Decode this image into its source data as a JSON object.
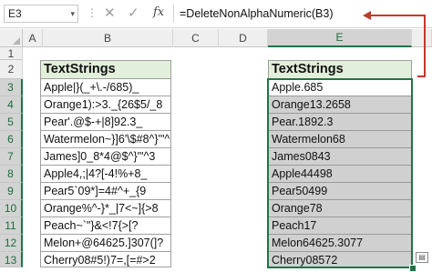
{
  "formula_bar": {
    "name_box": "E3",
    "name_box_dropdown": "▾",
    "separator": "⋮",
    "cancel_icon": "✕",
    "enter_icon": "✓",
    "fx_label": "fx",
    "formula": "=DeleteNonAlphaNumeric(B3)"
  },
  "columns": [
    "A",
    "B",
    "C",
    "D",
    "E"
  ],
  "rows": [
    "1",
    "2",
    "3",
    "4",
    "5",
    "6",
    "7",
    "8",
    "9",
    "10",
    "11",
    "12",
    "13"
  ],
  "table_b": {
    "header": "TextStrings",
    "values": [
      "Apple|}(_+\\.-/685)_",
      "Orange1):>3._{26$5/_8",
      "Pear'.@$-+|8]92.3_",
      "Watermelon~}]6'\\$#8^}'\"^",
      "James]0_8*4@$^}'\"^3",
      "Apple4,;|4?[-4!%+8_",
      "Pear5`09*]=4#^+_{9",
      "Orange%^-}*_|7<~]{>8",
      "Peach~`\"}&<!7{>[?",
      "Melon+@64625.]307(]?",
      "Cherry08#5!)7=,[=#>2"
    ]
  },
  "table_e": {
    "header": "TextStrings",
    "values": [
      "Apple.685",
      "Orange13.2658",
      "Pear.1892.3",
      "Watermelon68",
      "James0843",
      "Apple44498",
      "Pear50499",
      "Orange78",
      "Peach17",
      "Melon64625.3077",
      "Cherry08572"
    ]
  },
  "colors": {
    "accent": "#217346",
    "header_fill": "#e2efda",
    "result_fill": "#d0d0d0",
    "arrow": "#c0392b"
  }
}
